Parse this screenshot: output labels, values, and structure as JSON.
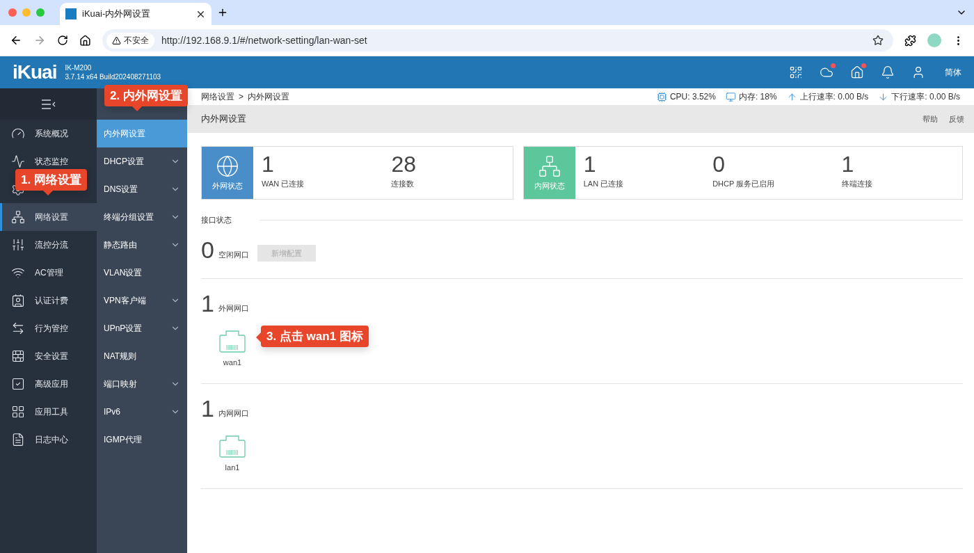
{
  "browser": {
    "tab_title": "iKuai-内外网设置",
    "security": "不安全",
    "url": "http://192.168.9.1/#/network-setting/lan-wan-set"
  },
  "header": {
    "logo": "iKuai",
    "model": "IK-M200",
    "build": "3.7.14 x64 Build202408271103",
    "icons": [
      {
        "badge": false
      },
      {
        "badge": true
      },
      {
        "badge": true
      },
      {
        "badge": false
      },
      {
        "badge": false
      }
    ],
    "language": "简体"
  },
  "sidebar": {
    "items": [
      {
        "label": "系统概况",
        "selected": false
      },
      {
        "label": "状态监控",
        "selected": false
      },
      {
        "selected": false
      },
      {
        "label": "网络设置",
        "selected": true
      },
      {
        "label": "流控分流",
        "selected": false
      },
      {
        "label": "AC管理",
        "selected": false
      },
      {
        "label": "认证计费",
        "selected": false
      },
      {
        "label": "行为管控",
        "selected": false
      },
      {
        "label": "安全设置",
        "selected": false
      },
      {
        "label": "高级应用",
        "selected": false
      },
      {
        "label": "应用工具",
        "selected": false
      },
      {
        "label": "日志中心",
        "selected": false
      }
    ]
  },
  "submenu": {
    "items": [
      {
        "label": "内外网设置",
        "selected": true,
        "expandable": false
      },
      {
        "label": "DHCP设置",
        "selected": false,
        "expandable": true
      },
      {
        "label": "DNS设置",
        "selected": false,
        "expandable": true
      },
      {
        "label": "终端分组设置",
        "selected": false,
        "expandable": true
      },
      {
        "label": "静态路由",
        "selected": false,
        "expandable": true
      },
      {
        "label": "VLAN设置",
        "selected": false,
        "expandable": false
      },
      {
        "label": "VPN客户端",
        "selected": false,
        "expandable": true
      },
      {
        "label": "UPnP设置",
        "selected": false,
        "expandable": true
      },
      {
        "label": "NAT规则",
        "selected": false,
        "expandable": false
      },
      {
        "label": "端口映射",
        "selected": false,
        "expandable": true
      },
      {
        "label": "IPv6",
        "selected": false,
        "expandable": true
      },
      {
        "label": "IGMP代理",
        "selected": false,
        "expandable": false
      }
    ]
  },
  "breadcrumb": {
    "items": [
      "网络设置",
      "内外网设置"
    ],
    "separator": ">"
  },
  "system_status": [
    {
      "kind": "cpu",
      "text": "CPU: 3.52%"
    },
    {
      "kind": "memory",
      "text": "内存: 18%"
    },
    {
      "kind": "upload",
      "text": "上行速率: 0.00 B/s"
    },
    {
      "kind": "download",
      "text": "下行速率: 0.00 B/s"
    }
  ],
  "page_title": "内外网设置",
  "actions": [
    "帮助",
    "反馈"
  ],
  "cards": [
    {
      "kind": "wan",
      "label": "外网状态",
      "color": "#4a8ec9",
      "stats": [
        {
          "value": "1",
          "label": "WAN 已连接"
        },
        {
          "value": "28",
          "label": "连接数"
        }
      ]
    },
    {
      "kind": "lan",
      "label": "内网状态",
      "color": "#5cc79b",
      "stats": [
        {
          "value": "1",
          "label": "LAN 已连接"
        },
        {
          "value": "0",
          "label": "DHCP 服务已启用"
        },
        {
          "value": "1",
          "label": "终端连接"
        }
      ]
    }
  ],
  "interface_status": {
    "title": "接口状态",
    "groups": [
      {
        "count": "0",
        "label": "空闲网口",
        "button": {
          "label": "新增配置",
          "disabled": true
        }
      },
      {
        "count": "1",
        "label": "外网网口",
        "ports": [
          {
            "name": "wan1"
          }
        ]
      },
      {
        "count": "1",
        "label": "内网网口",
        "ports": [
          {
            "name": "lan1"
          }
        ]
      }
    ]
  },
  "callouts": [
    {
      "text": "1. 网络设置",
      "kind": "down"
    },
    {
      "text": "2. 内外网设置",
      "kind": "down"
    },
    {
      "text": "3. 点击 wan1 图标",
      "kind": "left"
    }
  ]
}
